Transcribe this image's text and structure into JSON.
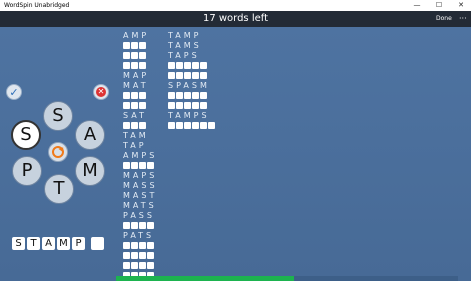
{
  "window": {
    "title": "WordSpin Unabridged",
    "minimize": "—",
    "maximize": "☐",
    "close": "✕"
  },
  "header": {
    "words_left": "17 words left",
    "done_label": "Done",
    "more_label": "···"
  },
  "actions": {
    "check_symbol": "✓",
    "cancel_symbol": "✕"
  },
  "tiles": [
    {
      "letter": "S",
      "selected": false
    },
    {
      "letter": "A",
      "selected": false
    },
    {
      "letter": "M",
      "selected": false
    },
    {
      "letter": "T",
      "selected": false
    },
    {
      "letter": "P",
      "selected": false
    },
    {
      "letter": "S",
      "selected": true
    }
  ],
  "entry": {
    "letters": [
      "S",
      "T",
      "A",
      "M",
      "P",
      ""
    ]
  },
  "word_list": {
    "columns": [
      [
        {
          "label": "AMP",
          "slots": 0
        },
        {
          "label": "",
          "slots": 3
        },
        {
          "label": "",
          "slots": 3
        },
        {
          "label": "",
          "slots": 3
        },
        {
          "label": "MAP",
          "slots": 0
        },
        {
          "label": "MAT",
          "slots": 0
        },
        {
          "label": "",
          "slots": 3
        },
        {
          "label": "",
          "slots": 3
        },
        {
          "label": "SAT",
          "slots": 0
        },
        {
          "label": "",
          "slots": 3
        },
        {
          "label": "TAM",
          "slots": 0
        },
        {
          "label": "TAP",
          "slots": 0
        },
        {
          "label": "AMPS",
          "slots": 0
        },
        {
          "label": "",
          "slots": 4
        },
        {
          "label": "MAPS",
          "slots": 0
        },
        {
          "label": "MASS",
          "slots": 0
        },
        {
          "label": "MAST",
          "slots": 0
        },
        {
          "label": "MATS",
          "slots": 0
        },
        {
          "label": "PASS",
          "slots": 0
        },
        {
          "label": "",
          "slots": 4
        },
        {
          "label": "PATS",
          "slots": 0
        },
        {
          "label": "",
          "slots": 4
        },
        {
          "label": "",
          "slots": 4
        },
        {
          "label": "",
          "slots": 4
        },
        {
          "label": "",
          "slots": 4
        }
      ],
      [
        {
          "label": "TAMP",
          "slots": 0
        },
        {
          "label": "TAMS",
          "slots": 0
        },
        {
          "label": "TAPS",
          "slots": 0
        },
        {
          "label": "",
          "slots": 5
        },
        {
          "label": "",
          "slots": 5
        },
        {
          "label": "SPASM",
          "slots": 0
        },
        {
          "label": "",
          "slots": 5
        },
        {
          "label": "",
          "slots": 5
        },
        {
          "label": "TAMPS",
          "slots": 0
        },
        {
          "label": "",
          "slots": 6
        }
      ]
    ]
  },
  "progress": {
    "fraction": 0.52
  },
  "colors": {
    "background": "#4a6e9a",
    "header": "#232b36",
    "progress": "#1db34f",
    "shuffle_accent": "#f07a1a"
  }
}
